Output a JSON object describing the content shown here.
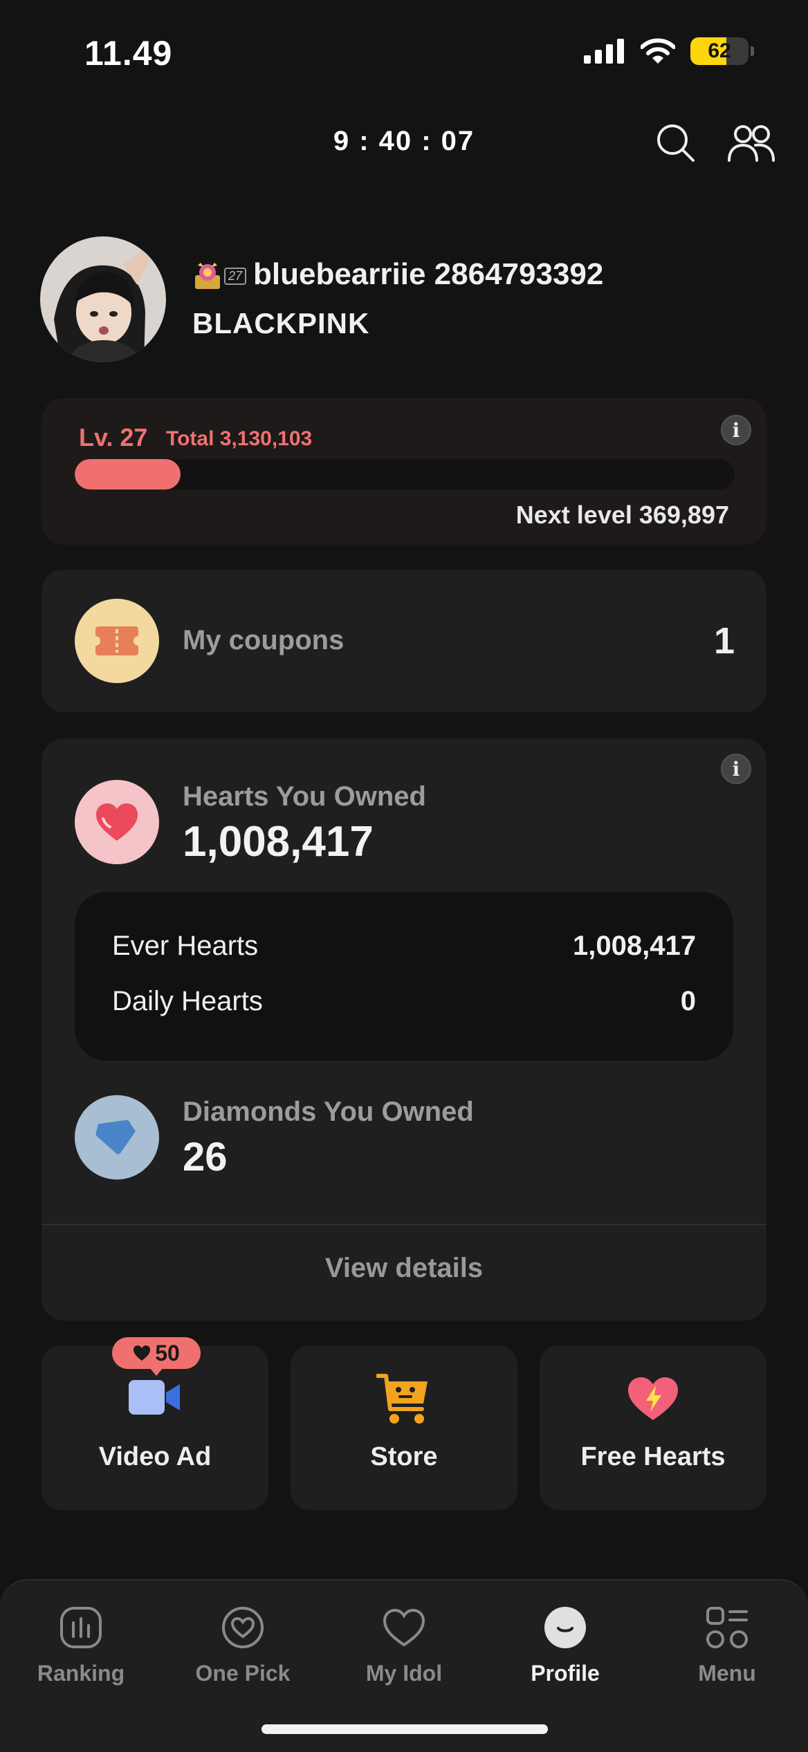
{
  "status_bar": {
    "time": "11.49",
    "battery": "62",
    "battery_level": 0.62
  },
  "header": {
    "timer": "9 : 40 : 07"
  },
  "profile": {
    "level_badge": "27",
    "username": "bluebearriie 2864793392",
    "group": "BLACKPINK"
  },
  "level": {
    "label": "Lv. 27",
    "total": "Total 3,130,103",
    "next_level": "Next level 369,897",
    "progress": 0.16
  },
  "coupons": {
    "label": "My coupons",
    "count": "1"
  },
  "hearts": {
    "label": "Hearts You Owned",
    "value": "1,008,417",
    "ever_label": "Ever Hearts",
    "ever_value": "1,008,417",
    "daily_label": "Daily Hearts",
    "daily_value": "0"
  },
  "diamonds": {
    "label": "Diamonds You Owned",
    "value": "26"
  },
  "view_details": "View details",
  "tiles": {
    "video_ad": "Video Ad",
    "video_ad_bonus": "50",
    "store": "Store",
    "free_hearts": "Free Hearts"
  },
  "nav": {
    "ranking": "Ranking",
    "one_pick": "One Pick",
    "my_idol": "My Idol",
    "profile": "Profile",
    "menu": "Menu"
  },
  "colors": {
    "accent": "#f07070",
    "background": "#131313",
    "card": "#1f1f1f",
    "battery": "#ffd60a"
  }
}
